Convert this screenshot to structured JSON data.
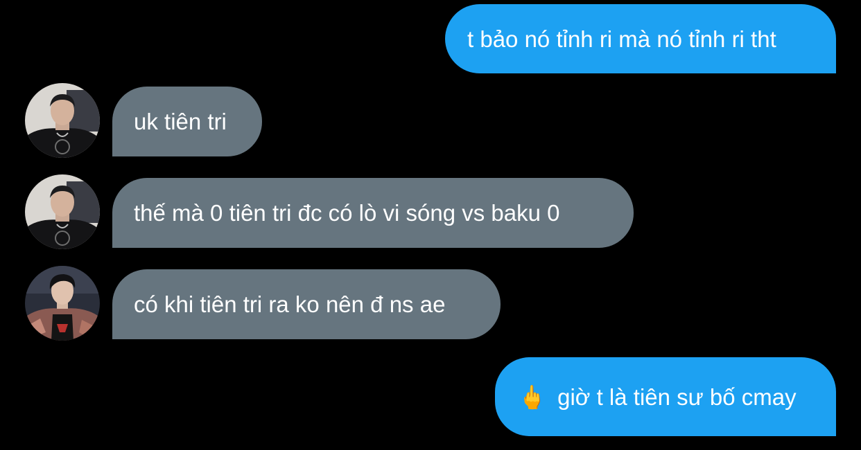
{
  "conversation": {
    "messages": [
      {
        "direction": "sent",
        "text": "t bảo nó tỉnh ri mà nó tỉnh ri tht"
      },
      {
        "direction": "received",
        "sender_avatar": "avatar-black-hoodie",
        "text": "uk tiên tri"
      },
      {
        "direction": "received",
        "sender_avatar": "avatar-black-hoodie",
        "text": "thế mà 0 tiên tri đc có lò vi sóng vs baku 0"
      },
      {
        "direction": "received",
        "sender_avatar": "avatar-patterned-jacket",
        "text": "có khi tiên tri ra ko nên đ ns ae"
      },
      {
        "direction": "sent",
        "emoji": "🖕",
        "text": "giờ t là tiên sư bố cmay"
      }
    ]
  },
  "colors": {
    "background": "#000000",
    "sent_bubble": "#1da1f2",
    "received_bubble": "#66757f",
    "text": "#ffffff"
  }
}
